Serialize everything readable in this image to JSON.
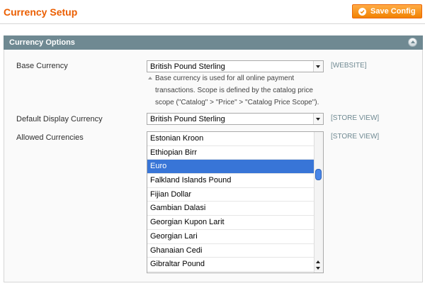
{
  "header": {
    "title": "Currency Setup",
    "save_label": "Save Config"
  },
  "section": {
    "title": "Currency Options",
    "base_currency": {
      "label": "Base Currency",
      "value": "British Pound Sterling",
      "scope": "[WEBSITE]",
      "note_lines": [
        "Base currency is used for all online payment",
        "transactions. Scope is defined by the catalog price",
        "scope (\"Catalog\" > \"Price\" > \"Catalog Price Scope\")."
      ]
    },
    "default_display": {
      "label": "Default Display Currency",
      "value": "British Pound Sterling",
      "scope": "[STORE VIEW]"
    },
    "allowed": {
      "label": "Allowed Currencies",
      "scope": "[STORE VIEW]",
      "options": [
        "Estonian Kroon",
        "Ethiopian Birr",
        "Euro",
        "Falkland Islands Pound",
        "Fijian Dollar",
        "Gambian Dalasi",
        "Georgian Kupon Larit",
        "Georgian Lari",
        "Ghanaian Cedi",
        "Gibraltar Pound"
      ],
      "selected": "Euro"
    }
  }
}
